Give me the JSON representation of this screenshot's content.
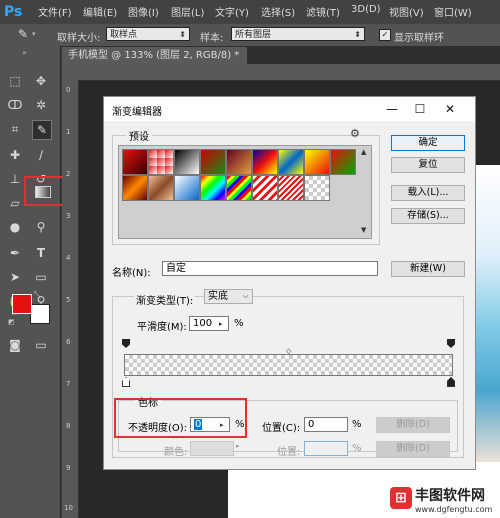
{
  "app": {
    "logo": "Ps",
    "menu": [
      "文件(F)",
      "编辑(E)",
      "图像(I)",
      "图层(L)",
      "文字(Y)",
      "选择(S)",
      "滤镜(T)",
      "3D(D)",
      "视图(V)",
      "窗口(W)"
    ]
  },
  "options_bar": {
    "sample_size_label": "取样大小:",
    "sample_size_value": "取样点",
    "sample_label": "样本:",
    "sample_value": "所有图层",
    "show_ring_label": "显示取样环"
  },
  "document": {
    "tab_title": "手机模型 @ 133% (图层 2, RGB/8) *",
    "tab_close": "×"
  },
  "ruler": {
    "left_ticks": [
      "0",
      "1",
      "2",
      "3",
      "4",
      "5",
      "6",
      "7",
      "8",
      "9",
      "10"
    ]
  },
  "colors": {
    "foreground": "#e81010",
    "background": "#ffffff",
    "accent_highlight": "#e03030",
    "ps_blue": "#31a8ff"
  },
  "dialog": {
    "title": "渐变编辑器",
    "presets_label": "预设",
    "gear_icon": "gear-icon",
    "buttons": {
      "ok": "确定",
      "reset": "复位",
      "load": "载入(L)...",
      "save": "存储(S)...",
      "new": "新建(W)"
    },
    "name_label": "名称(N):",
    "name_value": "自定",
    "gradient_type_label": "渐变类型(T):",
    "gradient_type_value": "实底",
    "smoothness_label": "平滑度(M):",
    "smoothness_value": "100",
    "smoothness_unit": "%",
    "stops_group_label": "色标",
    "opacity_label": "不透明度(O):",
    "opacity_value": "0",
    "opacity_unit": "%",
    "opacity_location_label": "位置(C):",
    "opacity_location_value": "0",
    "opacity_location_unit": "%",
    "opacity_delete": "删除(D)",
    "color_label": "颜色:",
    "color_location_label": "位置:",
    "color_location_unit": "%",
    "color_delete": "删除(D)"
  },
  "watermark": {
    "text": "丰图软件网",
    "url": "www.dgfengtu.com"
  }
}
